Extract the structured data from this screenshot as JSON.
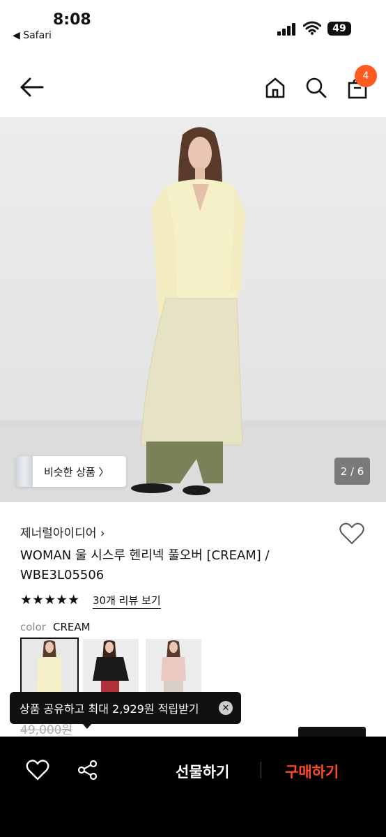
{
  "status_bar": {
    "time": "8:08",
    "back_app": "◀ Safari",
    "battery": "49"
  },
  "header": {
    "cart_count": "4",
    "badge_color": "#ff5a1f"
  },
  "gallery": {
    "similar_label": "비슷한 상품 〉",
    "page_indicator": "2 / 6"
  },
  "product": {
    "brand": "제너럴아이디어 ›",
    "title_line1": "WOMAN 울 시스루 헨리넥 풀오버 [CREAM] /",
    "title_line2": "WBE3L05506",
    "stars": "★★★★★",
    "review_link": "30개 리뷰 보기",
    "color_label": "color",
    "color_value": "CREAM",
    "price_old": "49,000원"
  },
  "tooltip": {
    "text": "상품 공유하고 최대 2,929원 적립받기",
    "close": "✕"
  },
  "bottom_bar": {
    "gift_label": "선물하기",
    "buy_label": "구매하기",
    "buy_color": "#ff4b1f"
  },
  "icons": [
    "back-arrow-icon",
    "home-icon",
    "search-icon",
    "shopping-bag-icon",
    "heart-icon",
    "share-icon",
    "signal-icon",
    "wifi-icon",
    "battery-icon"
  ]
}
